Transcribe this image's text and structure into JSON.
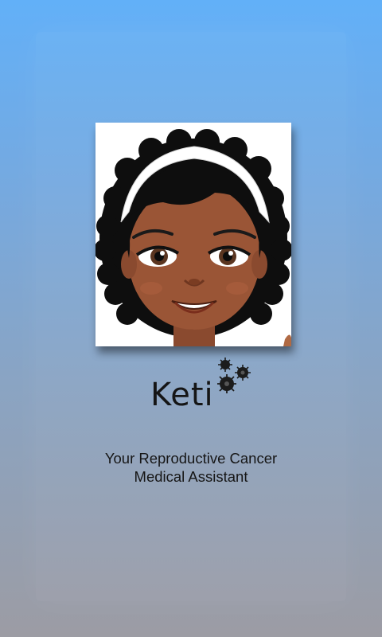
{
  "app": {
    "logo_text": "Keti",
    "tagline_line1": "Your Reproductive Cancer",
    "tagline_line2": "Medical Assistant"
  },
  "icons": {
    "avatar": "cartoon-woman-avatar",
    "logo_mark": "virus-cells-icon"
  },
  "colors": {
    "background_top": "#62b0f8",
    "background_bottom": "#9c9ca4",
    "text": "#161616"
  }
}
